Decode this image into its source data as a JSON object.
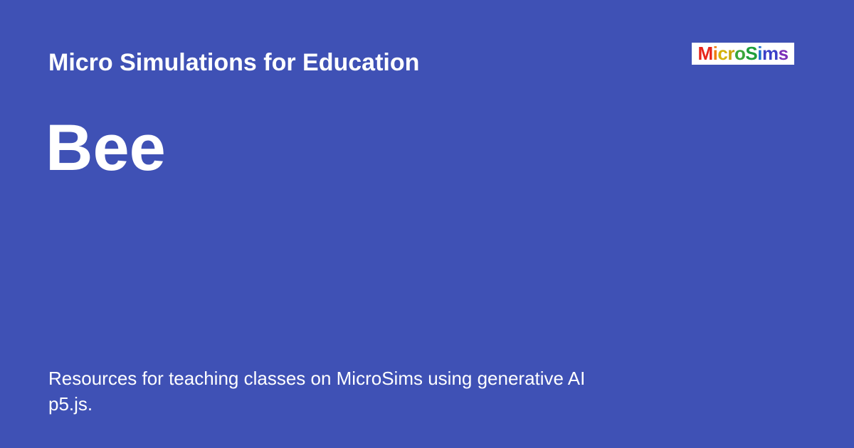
{
  "header": {
    "site_name": "Micro Simulations for Education"
  },
  "page": {
    "title": "Bee"
  },
  "description": {
    "line1": "Resources for teaching classes on MicroSims using generative AI",
    "line2": "p5.js."
  },
  "logo": {
    "text": "MicroSims",
    "letter_colors": [
      "#e8241a",
      "#f07d12",
      "#d4b20a",
      "#c9a40a",
      "#3aa63a",
      "#1f9e3c",
      "#1f6fd1",
      "#3a3fc8",
      "#7a2fb8"
    ],
    "background": "#ffffff"
  },
  "colors": {
    "background": "#3f51b5",
    "text": "#ffffff"
  }
}
